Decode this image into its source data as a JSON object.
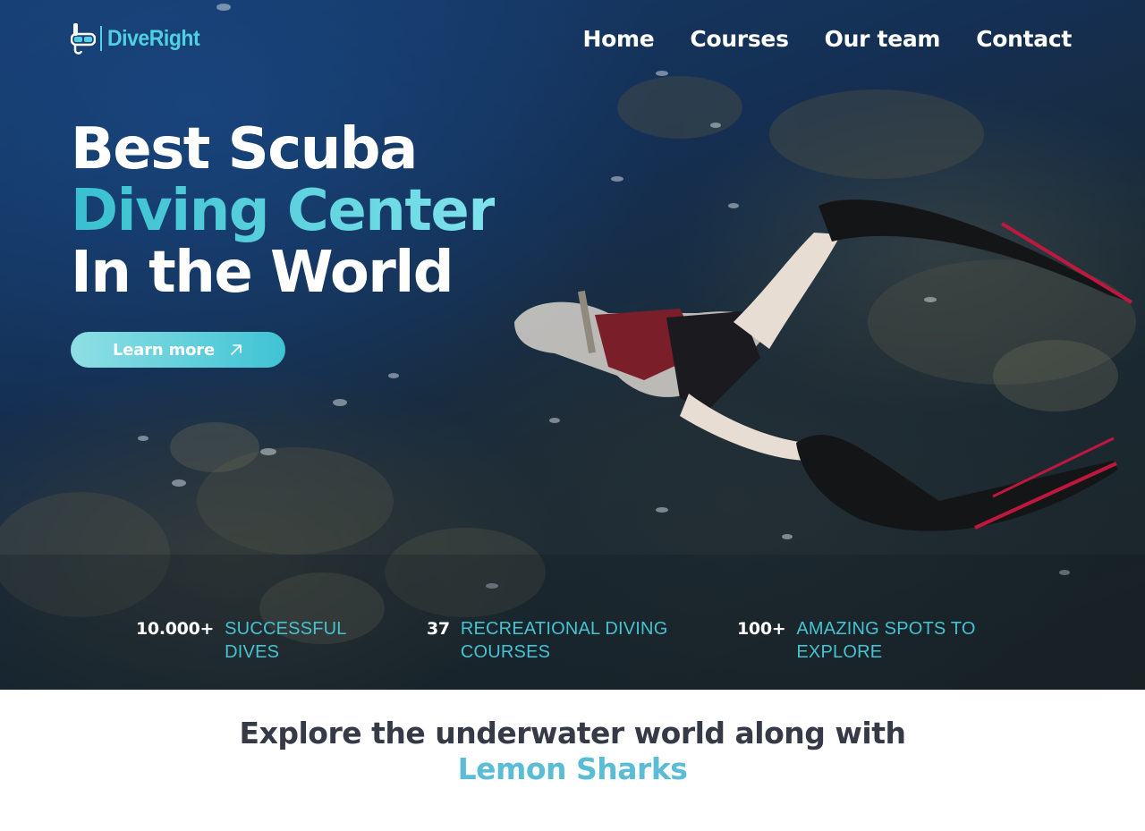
{
  "brand": {
    "name": "DiveRight",
    "icon": "snorkel-mask-icon",
    "accent_color": "#4fd0e3"
  },
  "nav": {
    "items": [
      {
        "label": "Home"
      },
      {
        "label": "Courses"
      },
      {
        "label": "Our team"
      },
      {
        "label": "Contact"
      }
    ]
  },
  "hero": {
    "headline_line1": "Best Scuba",
    "headline_line2": "Diving Center",
    "headline_line3": "In the World",
    "cta_label": "Learn more",
    "cta_icon": "arrow-up-right-icon"
  },
  "stats": [
    {
      "value": "10.000+",
      "label": "SUCCESSFUL DIVES"
    },
    {
      "value": "37",
      "label": "RECREATIONAL DIVING COURSES"
    },
    {
      "value": "100+",
      "label": "AMAZING SPOTS TO EXPLORE"
    }
  ],
  "section": {
    "title_line1": "Explore the underwater world along with",
    "title_line2": "Lemon Sharks"
  },
  "colors": {
    "headline_accent": "#38c0cf",
    "stat_label": "#45c3d2",
    "section_title": "#363a47",
    "section_accent": "#5bbcd6"
  }
}
